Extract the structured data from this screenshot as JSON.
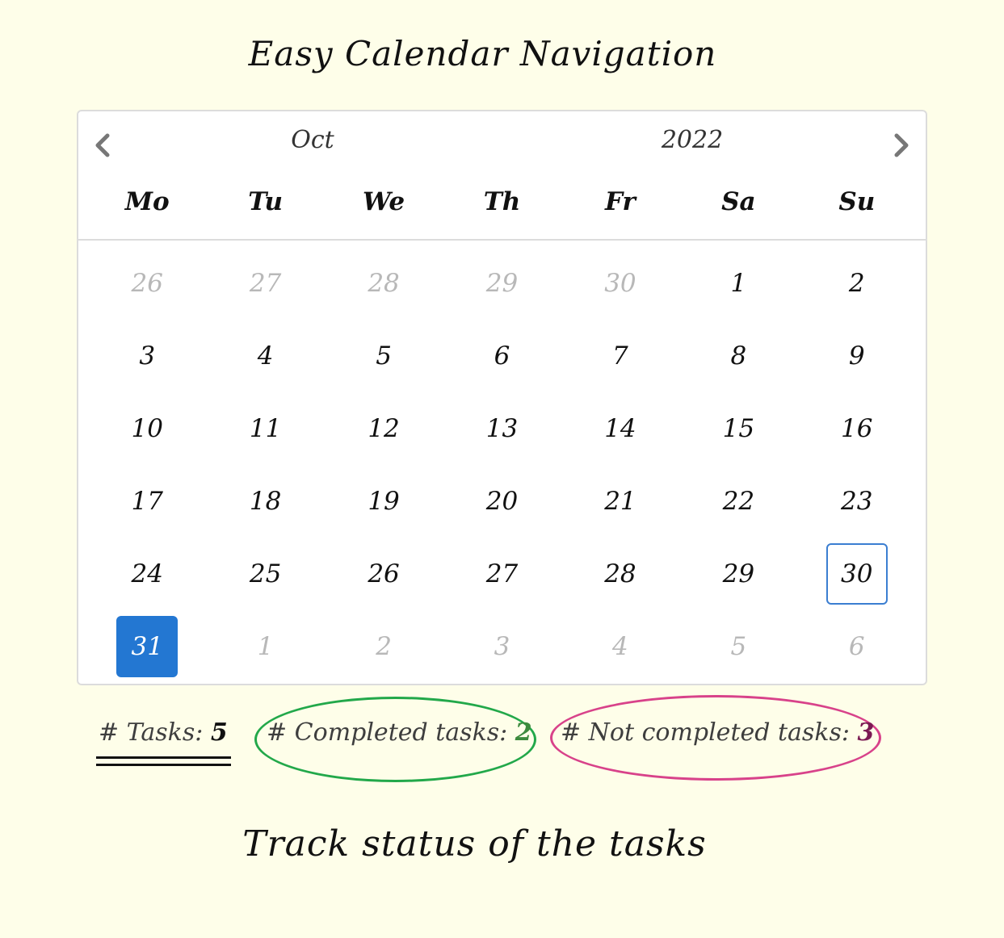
{
  "title": "Easy Calendar Navigation",
  "caption": "Track status of the tasks",
  "calendar": {
    "month": "Oct",
    "year": "2022",
    "prev_icon": "chevron-left-icon",
    "next_icon": "chevron-right-icon",
    "weekdays": [
      "Mo",
      "Tu",
      "We",
      "Th",
      "Fr",
      "Sa",
      "Su"
    ],
    "days": [
      {
        "label": "26",
        "muted": true
      },
      {
        "label": "27",
        "muted": true
      },
      {
        "label": "28",
        "muted": true
      },
      {
        "label": "29",
        "muted": true
      },
      {
        "label": "30",
        "muted": true
      },
      {
        "label": "1"
      },
      {
        "label": "2"
      },
      {
        "label": "3"
      },
      {
        "label": "4"
      },
      {
        "label": "5"
      },
      {
        "label": "6"
      },
      {
        "label": "7"
      },
      {
        "label": "8"
      },
      {
        "label": "9"
      },
      {
        "label": "10"
      },
      {
        "label": "11"
      },
      {
        "label": "12"
      },
      {
        "label": "13"
      },
      {
        "label": "14"
      },
      {
        "label": "15"
      },
      {
        "label": "16"
      },
      {
        "label": "17"
      },
      {
        "label": "18"
      },
      {
        "label": "19"
      },
      {
        "label": "20"
      },
      {
        "label": "21"
      },
      {
        "label": "22"
      },
      {
        "label": "23"
      },
      {
        "label": "24"
      },
      {
        "label": "25"
      },
      {
        "label": "26"
      },
      {
        "label": "27"
      },
      {
        "label": "28"
      },
      {
        "label": "29"
      },
      {
        "label": "30",
        "today": true
      },
      {
        "label": "31",
        "selected": true
      },
      {
        "label": "1",
        "muted": true
      },
      {
        "label": "2",
        "muted": true
      },
      {
        "label": "3",
        "muted": true
      },
      {
        "label": "4",
        "muted": true
      },
      {
        "label": "5",
        "muted": true
      },
      {
        "label": "6",
        "muted": true
      }
    ]
  },
  "stats": {
    "total_label": "# Tasks: ",
    "total_value": "5",
    "completed_label": "# Completed tasks: ",
    "completed_value": "2",
    "not_completed_label": "# Not completed tasks: ",
    "not_completed_value": "3"
  },
  "colors": {
    "background": "#fefee9",
    "selected": "#2377d2",
    "today_border": "#3b7ed1",
    "completed_highlight": "#22a84a",
    "not_completed_highlight": "#d8428a",
    "completed_value": "#3d8a3d",
    "not_completed_value": "#7b1a53"
  }
}
